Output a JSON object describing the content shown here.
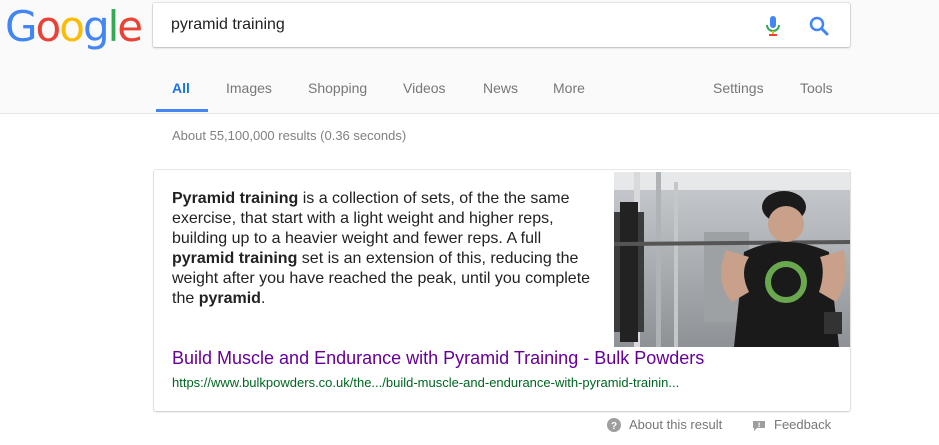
{
  "logo": {
    "letters": [
      "G",
      "o",
      "o",
      "g",
      "l",
      "e"
    ],
    "colors": [
      "#4285f4",
      "#ea4335",
      "#fbbc05",
      "#4285f4",
      "#34a853",
      "#ea4335"
    ]
  },
  "search": {
    "value": "pyramid training",
    "mic_icon": "mic-icon",
    "search_icon": "search-icon"
  },
  "tabs": [
    {
      "label": "All",
      "active": true
    },
    {
      "label": "Images"
    },
    {
      "label": "Shopping"
    },
    {
      "label": "Videos"
    },
    {
      "label": "News"
    },
    {
      "label": "More"
    },
    {
      "label": "Settings"
    },
    {
      "label": "Tools"
    }
  ],
  "result_stats": "About 55,100,000 results (0.36 seconds)",
  "featured_snippet": {
    "text_parts": [
      {
        "text": "Pyramid training",
        "bold": true
      },
      {
        "text": " is a collection of sets, of the the same exercise, that start with a light weight and higher reps, building up to a heavier weight and fewer reps. A full ",
        "bold": false
      },
      {
        "text": "pyramid training",
        "bold": true
      },
      {
        "text": " set is an extension of this, reducing the weight after you have reached the peak, until you complete the ",
        "bold": false
      },
      {
        "text": "pyramid",
        "bold": true
      },
      {
        "text": ".",
        "bold": false
      }
    ],
    "image_icon": "gym-photo",
    "title": "Build Muscle and Endurance with Pyramid Training - Bulk Powders",
    "url": "https://www.bulkpowders.co.uk/the.../build-muscle-and-endurance-with-pyramid-trainin..."
  },
  "footer": {
    "about": "About this result",
    "feedback": "Feedback"
  },
  "colors": {
    "link_visited": "#660099",
    "url_green": "#006621",
    "active_tab": "#1a73e8"
  }
}
